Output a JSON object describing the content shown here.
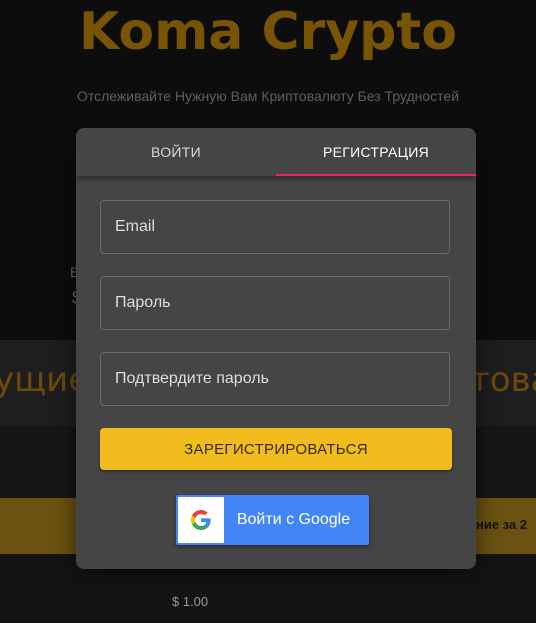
{
  "brand": {
    "title": "Koma Crypto",
    "tagline": "Отслеживайте Нужную Вам Криптовалюту Без Трудностей"
  },
  "background": {
    "fragment_v": "В",
    "fragment_dollar": "$",
    "heading_left": "ущие",
    "heading_right": "това",
    "banner_text": "ние за 2",
    "price": "$ 1.00"
  },
  "auth_modal": {
    "tabs": [
      {
        "label": "ВОЙТИ",
        "active": false
      },
      {
        "label": "РЕГИСТРАЦИЯ",
        "active": true
      }
    ],
    "fields": {
      "email_placeholder": "Email",
      "password_placeholder": "Пароль",
      "confirm_placeholder": "Подтвердите пароль"
    },
    "register_label": "ЗАРЕГИСТРИРОВАТЬСЯ",
    "google_label": "Войти с Google",
    "google_icon": "google-g-icon"
  },
  "colors": {
    "accent_gold": "#f0bc1e",
    "tab_underline": "#e8285a",
    "google_blue": "#4285f4",
    "modal_bg": "#454545"
  }
}
